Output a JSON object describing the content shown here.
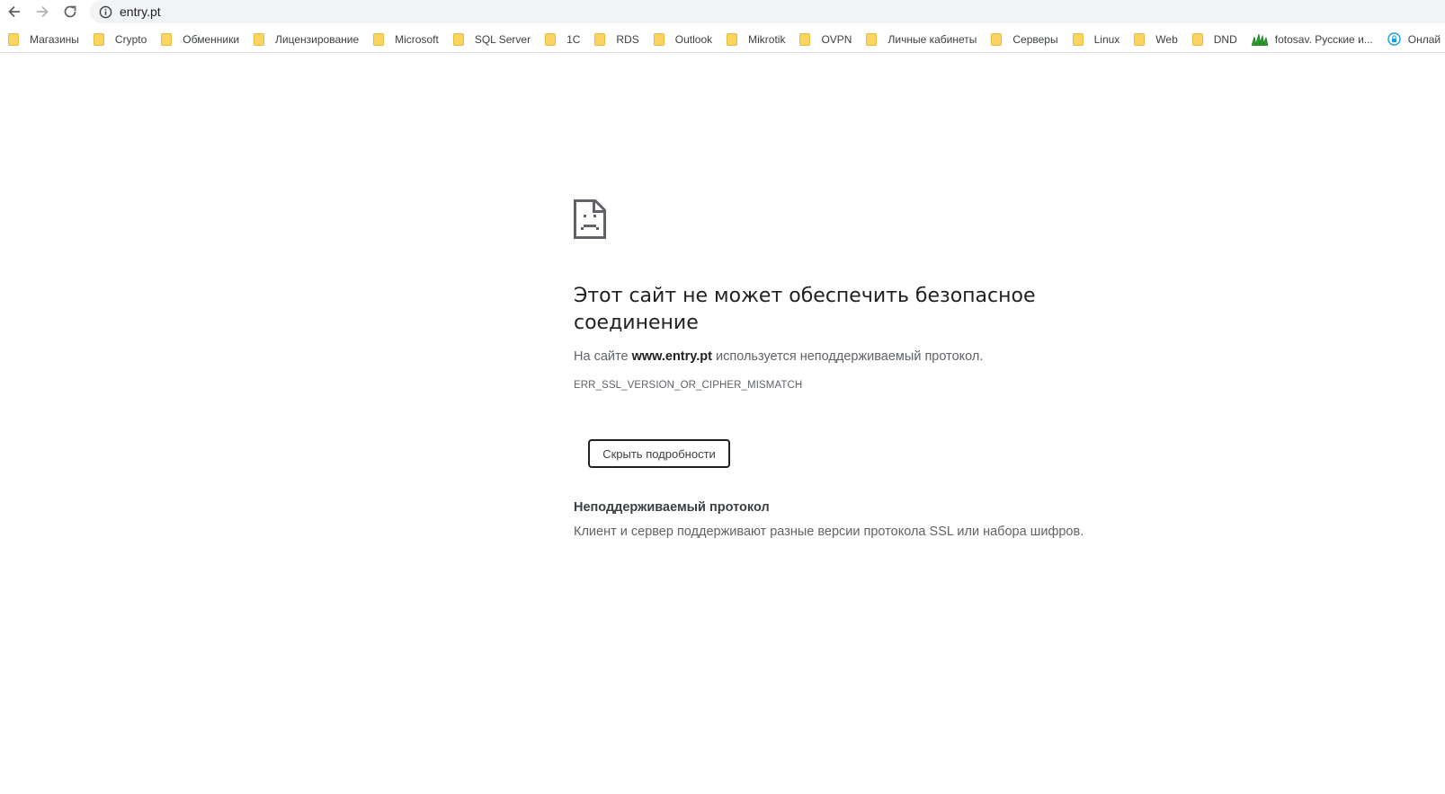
{
  "toolbar": {
    "back_icon": "arrow-left-icon",
    "forward_icon": "arrow-right-icon",
    "reload_icon": "reload-icon",
    "url": "entry.pt"
  },
  "bookmarks": [
    {
      "label": "Магазины",
      "icon": "folder-icon"
    },
    {
      "label": "Crypto",
      "icon": "folder-icon"
    },
    {
      "label": "Обменники",
      "icon": "folder-icon"
    },
    {
      "label": "Лицензирование",
      "icon": "folder-icon"
    },
    {
      "label": "Microsoft",
      "icon": "folder-icon"
    },
    {
      "label": "SQL Server",
      "icon": "folder-icon"
    },
    {
      "label": "1С",
      "icon": "folder-icon"
    },
    {
      "label": "RDS",
      "icon": "folder-icon"
    },
    {
      "label": "Outlook",
      "icon": "folder-icon"
    },
    {
      "label": "Mikrotik",
      "icon": "folder-icon"
    },
    {
      "label": "OVPN",
      "icon": "folder-icon"
    },
    {
      "label": "Личные кабинеты",
      "icon": "folder-icon"
    },
    {
      "label": "Серверы",
      "icon": "folder-icon"
    },
    {
      "label": "Linux",
      "icon": "folder-icon"
    },
    {
      "label": "Web",
      "icon": "folder-icon"
    },
    {
      "label": "DND",
      "icon": "folder-icon"
    },
    {
      "label": "fotosav. Русские и...",
      "icon": "grass-favicon"
    },
    {
      "label": "Онлай",
      "icon": "lock-favicon"
    }
  ],
  "error": {
    "title": "Этот сайт не может обеспечить безопасное соединение",
    "desc_prefix": "На сайте ",
    "desc_host": "www.entry.pt",
    "desc_suffix": " используется неподдерживаемый протокол.",
    "code": "ERR_SSL_VERSION_OR_CIPHER_MISMATCH",
    "details_button": "Скрыть подробности",
    "details_title": "Неподдерживаемый протокол",
    "details_text": "Клиент и сервер поддерживают разные версии протокола SSL или набора шифров."
  },
  "colors": {
    "folder": "#fcd462",
    "omnibox_bg": "#f1f3f4",
    "text_primary": "#202124",
    "text_secondary": "#5f6368"
  }
}
